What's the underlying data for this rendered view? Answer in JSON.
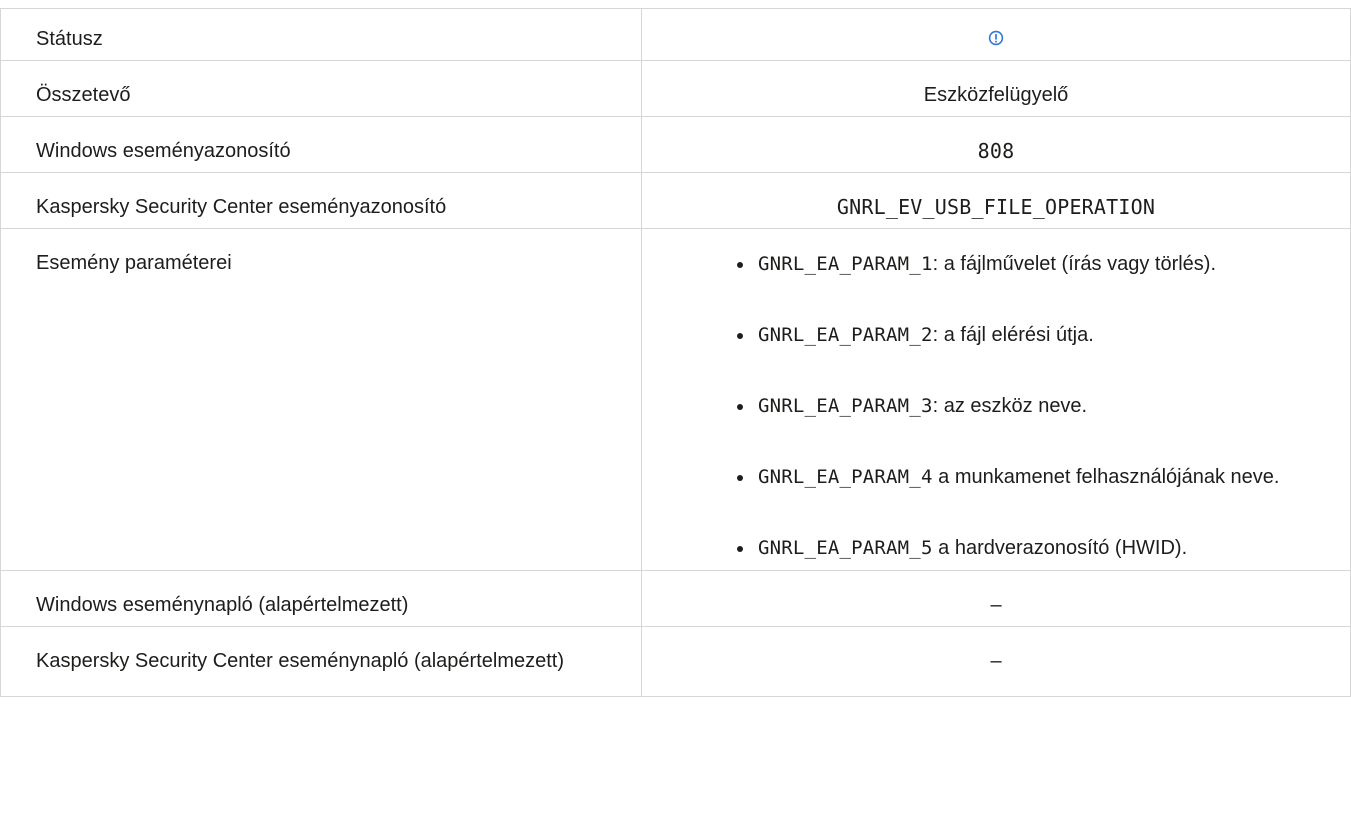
{
  "rows": {
    "status": {
      "label": "Státusz",
      "icon": "info-icon",
      "icon_color": "#2d7ad6"
    },
    "component": {
      "label": "Összetevő",
      "value": "Eszközfelügyelő"
    },
    "windows_event_id": {
      "label": "Windows eseményazonosító",
      "value": "808"
    },
    "ksc_event_id": {
      "label": "Kaspersky Security Center eseményazonosító",
      "value": "GNRL_EV_USB_FILE_OPERATION"
    },
    "event_params": {
      "label": "Esemény paraméterei",
      "items": [
        {
          "code": "GNRL_EA_PARAM_1",
          "text": ": a fájlművelet (írás vagy törlés)."
        },
        {
          "code": "GNRL_EA_PARAM_2",
          "text": ": a fájl elérési útja."
        },
        {
          "code": "GNRL_EA_PARAM_3",
          "text": ": az eszköz neve."
        },
        {
          "code": "GNRL_EA_PARAM_4",
          "text": " a munkamenet felhasználójának neve."
        },
        {
          "code": "GNRL_EA_PARAM_5",
          "text": " a hardverazonosító (HWID)."
        }
      ]
    },
    "windows_event_log": {
      "label": "Windows eseménynapló (alapértelmezett)",
      "value": "–"
    },
    "ksc_event_log": {
      "label": "Kaspersky Security Center eseménynapló (alapértelmezett)",
      "value": "–"
    }
  }
}
